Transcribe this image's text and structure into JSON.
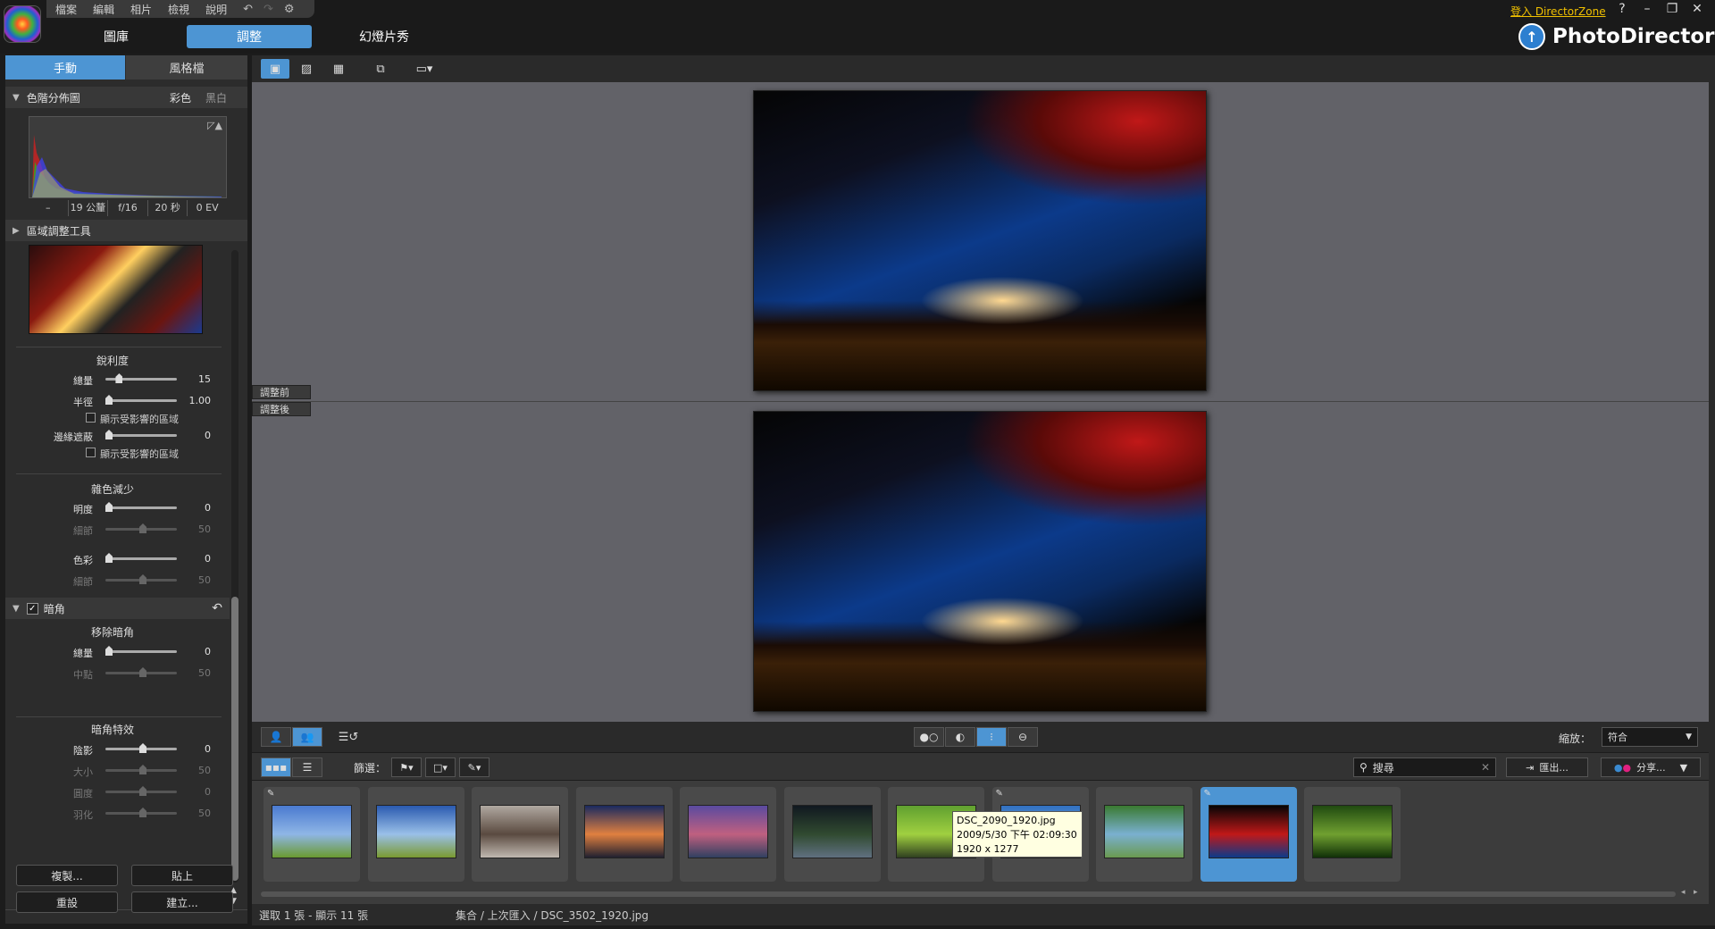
{
  "menu": {
    "items": [
      "檔案",
      "編輯",
      "相片",
      "檢視",
      "說明"
    ],
    "icons": [
      "undo-icon",
      "redo-icon",
      "gear-icon"
    ]
  },
  "main_tabs": [
    {
      "label": "圖庫",
      "active": false
    },
    {
      "label": "調整",
      "active": true
    },
    {
      "label": "幻燈片秀",
      "active": false
    }
  ],
  "header": {
    "directorzone": "登入 DirectorZone",
    "help": "?",
    "brand": "PhotoDirector"
  },
  "left_panel": {
    "tabs": [
      "手動",
      "風格檔"
    ],
    "histogram": {
      "title": "色階分佈圖",
      "color": "彩色",
      "bw": "黑白",
      "exif": [
        "–",
        "19 公釐",
        "f/16",
        "20 秒",
        "0 EV"
      ]
    },
    "regional": {
      "title": "區域調整工具"
    },
    "sharpness": {
      "title": "銳利度",
      "amount": {
        "label": "總量",
        "value": "15",
        "level": 0.15
      },
      "radius": {
        "label": "半徑",
        "value": "1.00",
        "level": 0.0
      },
      "show_affected_1": "顯示受影響的區域",
      "edge_mask": {
        "label": "邊緣遮蔽",
        "value": "0",
        "level": 0.0
      },
      "show_affected_2": "顯示受影響的區域"
    },
    "noise": {
      "title": "雜色減少",
      "luminance": {
        "label": "明度",
        "value": "0",
        "level": 0.0
      },
      "lum_detail": {
        "label": "細節",
        "value": "50",
        "level": 0.5
      },
      "color": {
        "label": "色彩",
        "value": "0",
        "level": 0.0
      },
      "color_detail": {
        "label": "細節",
        "value": "50",
        "level": 0.5
      }
    },
    "vignette": {
      "title": "暗角",
      "remove_title": "移除暗角",
      "amount": {
        "label": "總量",
        "value": "0",
        "level": 0.0
      },
      "midpoint": {
        "label": "中點",
        "value": "50",
        "level": 0.5
      },
      "effect_title": "暗角特效",
      "shadow": {
        "label": "陰影",
        "value": "0",
        "level": 0.5
      },
      "size": {
        "label": "大小",
        "value": "50",
        "level": 0.5
      },
      "roundness": {
        "label": "圓度",
        "value": "0",
        "level": 0.5
      },
      "feather": {
        "label": "羽化",
        "value": "50",
        "level": 0.5
      }
    },
    "buttons": {
      "copy": "複製...",
      "paste": "貼上",
      "reset": "重設",
      "create": "建立..."
    }
  },
  "viewer": {
    "before_label": "調整前",
    "after_label": "調整後",
    "zoom_label": "縮放：",
    "zoom_value": "符合"
  },
  "filmstrip": {
    "filter_label": "篩選：",
    "search_placeholder": "搜尋",
    "export": "匯出...",
    "share": "分享...",
    "tooltip": {
      "filename": "DSC_2090_1920.jpg",
      "datetime": "2009/5/30 下午 02:09:30",
      "size": "1920 x 1277"
    },
    "thumbs": [
      {
        "edited": true,
        "colors": [
          "#4a7ad0",
          "#8fb6e6",
          "#6a9a30"
        ],
        "selected": false
      },
      {
        "edited": false,
        "colors": [
          "#2a5ab0",
          "#9ac0e8",
          "#7a9a30"
        ],
        "selected": false
      },
      {
        "edited": false,
        "colors": [
          "#b0a8a0",
          "#5a4a40",
          "#c0b8b0"
        ],
        "selected": false
      },
      {
        "edited": false,
        "colors": [
          "#1a2a60",
          "#e08040",
          "#202030"
        ],
        "selected": false
      },
      {
        "edited": false,
        "colors": [
          "#5a4aa0",
          "#c06080",
          "#304060"
        ],
        "selected": false
      },
      {
        "edited": false,
        "colors": [
          "#101820",
          "#304a30",
          "#607080"
        ],
        "selected": false
      },
      {
        "edited": false,
        "colors": [
          "#60a030",
          "#a0d040",
          "#304020"
        ],
        "selected": false
      },
      {
        "edited": true,
        "colors": [
          "#3070c0",
          "#80b0e0",
          "#405030"
        ],
        "selected": false
      },
      {
        "edited": false,
        "colors": [
          "#3a7a30",
          "#7ab0d0",
          "#6a9a50"
        ],
        "selected": false
      },
      {
        "edited": true,
        "colors": [
          "#050505",
          "#c01818",
          "#0c3a8a"
        ],
        "selected": true
      },
      {
        "edited": false,
        "colors": [
          "#204a10",
          "#70a030",
          "#103008"
        ],
        "selected": false
      }
    ]
  },
  "status": {
    "selection": "選取 1 張 - 顯示 11 張",
    "path": "集合 / 上次匯入 / DSC_3502_1920.jpg"
  },
  "accent_color": "#4d95d3"
}
